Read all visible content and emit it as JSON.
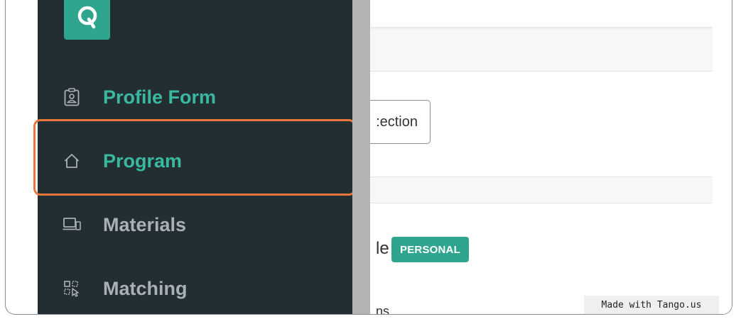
{
  "colors": {
    "sidebar_bg": "#232e32",
    "accent": "#2fa58e",
    "active_text": "#3ab8a0",
    "muted_text": "#a9b1b5",
    "highlight": "#e9773b"
  },
  "sidebar": {
    "logo_icon": "q-logo-icon",
    "items": [
      {
        "label": "Profile Form",
        "icon": "id-badge-icon",
        "state": "active"
      },
      {
        "label": "Program",
        "icon": "home-icon",
        "state": "active-highlighted"
      },
      {
        "label": "Materials",
        "icon": "devices-icon",
        "state": "muted"
      },
      {
        "label": "Matching",
        "icon": "match-grid-icon",
        "state": "muted"
      }
    ]
  },
  "main": {
    "section_button": ":ection",
    "partial_label": "le",
    "badge": "PERSONAL",
    "partial_link": "ns"
  },
  "watermark": "Made with Tango.us"
}
